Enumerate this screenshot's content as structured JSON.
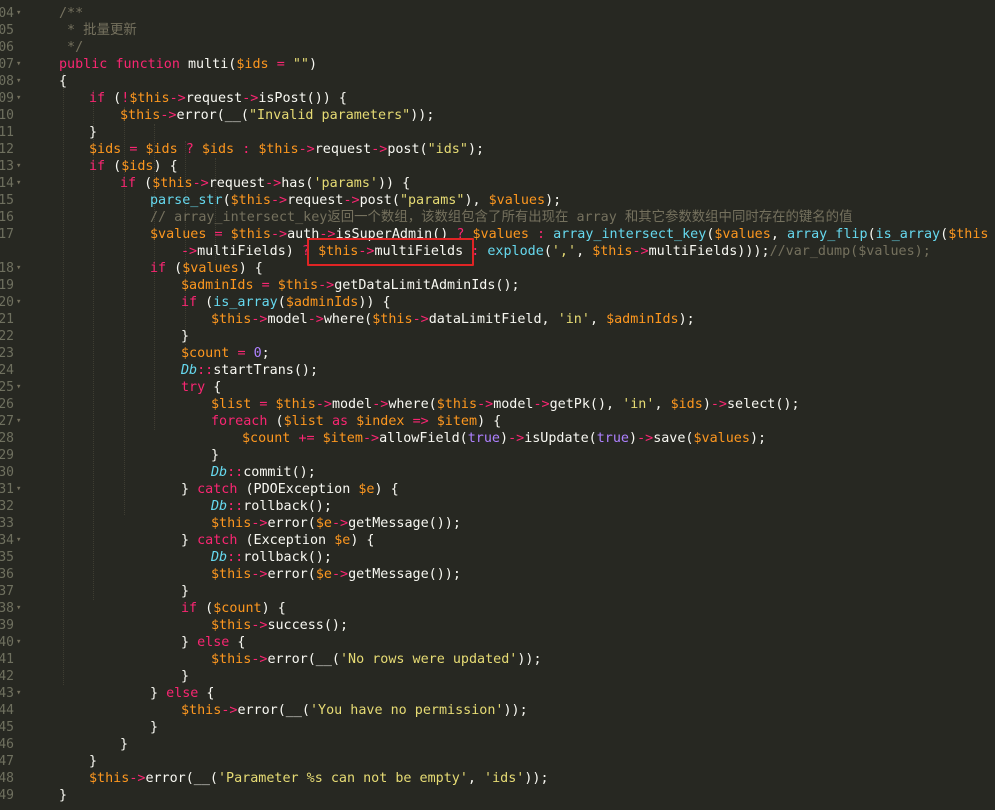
{
  "editor": {
    "line_numbers": [
      "04",
      "05",
      "06",
      "07",
      "08",
      "09",
      "10",
      "11",
      "12",
      "13",
      "14",
      "15",
      "16",
      "17",
      "",
      "18",
      "19",
      "20",
      "21",
      "22",
      "23",
      "24",
      "25",
      "26",
      "27",
      "28",
      "29",
      "30",
      "31",
      "32",
      "33",
      "34",
      "35",
      "36",
      "37",
      "38",
      "39",
      "40",
      "41",
      "42",
      "43",
      "44",
      "45",
      "46",
      "47",
      "48",
      "49"
    ],
    "lines": [
      [
        [
          "cm",
          "/**"
        ]
      ],
      [
        [
          "cm",
          " * 批量更新"
        ]
      ],
      [
        [
          "cm",
          " */"
        ]
      ],
      [
        [
          "kw",
          "public"
        ],
        [
          "txt",
          " "
        ],
        [
          "kw",
          "function"
        ],
        [
          "txt",
          " multi("
        ],
        [
          "var",
          "$ids"
        ],
        [
          "txt",
          " "
        ],
        [
          "kw",
          "="
        ],
        [
          "txt",
          " "
        ],
        [
          "str",
          "\"\""
        ],
        [
          "txt",
          ")"
        ]
      ],
      [
        [
          "txt",
          "{"
        ]
      ],
      [
        [
          "kw",
          "if"
        ],
        [
          "txt",
          " ("
        ],
        [
          "kw",
          "!"
        ],
        [
          "var",
          "$this"
        ],
        [
          "kw",
          "->"
        ],
        [
          "txt",
          "request"
        ],
        [
          "kw",
          "->"
        ],
        [
          "txt",
          "isPost()) {"
        ]
      ],
      [
        [
          "var",
          "$this"
        ],
        [
          "kw",
          "->"
        ],
        [
          "txt",
          "error(__("
        ],
        [
          "str",
          "\"Invalid parameters\""
        ],
        [
          "txt",
          "));"
        ]
      ],
      [
        [
          "txt",
          "}"
        ]
      ],
      [
        [
          "var",
          "$ids"
        ],
        [
          "txt",
          " "
        ],
        [
          "kw",
          "="
        ],
        [
          "txt",
          " "
        ],
        [
          "var",
          "$ids"
        ],
        [
          "txt",
          " "
        ],
        [
          "kw",
          "?"
        ],
        [
          "txt",
          " "
        ],
        [
          "var",
          "$ids"
        ],
        [
          "txt",
          " "
        ],
        [
          "kw",
          ":"
        ],
        [
          "txt",
          " "
        ],
        [
          "var",
          "$this"
        ],
        [
          "kw",
          "->"
        ],
        [
          "txt",
          "request"
        ],
        [
          "kw",
          "->"
        ],
        [
          "txt",
          "post("
        ],
        [
          "str",
          "\"ids\""
        ],
        [
          "txt",
          ");"
        ]
      ],
      [
        [
          "kw",
          "if"
        ],
        [
          "txt",
          " ("
        ],
        [
          "var",
          "$ids"
        ],
        [
          "txt",
          ") {"
        ]
      ],
      [
        [
          "kw",
          "if"
        ],
        [
          "txt",
          " ("
        ],
        [
          "var",
          "$this"
        ],
        [
          "kw",
          "->"
        ],
        [
          "txt",
          "request"
        ],
        [
          "kw",
          "->"
        ],
        [
          "txt",
          "has("
        ],
        [
          "str",
          "'params'"
        ],
        [
          "txt",
          ")) {"
        ]
      ],
      [
        [
          "fn",
          "parse_str"
        ],
        [
          "txt",
          "("
        ],
        [
          "var",
          "$this"
        ],
        [
          "kw",
          "->"
        ],
        [
          "txt",
          "request"
        ],
        [
          "kw",
          "->"
        ],
        [
          "txt",
          "post("
        ],
        [
          "str",
          "\"params\""
        ],
        [
          "txt",
          "), "
        ],
        [
          "var",
          "$values"
        ],
        [
          "txt",
          ");"
        ]
      ],
      [
        [
          "cm",
          "// array_intersect_key返回一个数组，该数组包含了所有出现在 array 和其它参数数组中同时存在的键名的值"
        ]
      ],
      [
        [
          "var",
          "$values"
        ],
        [
          "txt",
          " "
        ],
        [
          "kw",
          "="
        ],
        [
          "txt",
          " "
        ],
        [
          "var",
          "$this"
        ],
        [
          "kw",
          "->"
        ],
        [
          "txt",
          "auth"
        ],
        [
          "kw",
          "->"
        ],
        [
          "txt",
          "isSuperAdmin() "
        ],
        [
          "kw",
          "?"
        ],
        [
          "txt",
          " "
        ],
        [
          "var",
          "$values"
        ],
        [
          "txt",
          " "
        ],
        [
          "kw",
          ":"
        ],
        [
          "txt",
          " "
        ],
        [
          "fn",
          "array_intersect_key"
        ],
        [
          "txt",
          "("
        ],
        [
          "var",
          "$values"
        ],
        [
          "txt",
          ", "
        ],
        [
          "fn",
          "array_flip"
        ],
        [
          "txt",
          "("
        ],
        [
          "fn",
          "is_array"
        ],
        [
          "txt",
          "("
        ],
        [
          "var",
          "$this"
        ]
      ],
      [
        [
          "kw",
          "->"
        ],
        [
          "txt",
          "multiFields) "
        ],
        [
          "kw",
          "?"
        ],
        [
          "txt",
          " "
        ],
        [
          "var",
          "$this"
        ],
        [
          "kw",
          "->"
        ],
        [
          "txt",
          "multiFields "
        ],
        [
          "kw",
          ":"
        ],
        [
          "txt",
          " "
        ],
        [
          "fn",
          "explode"
        ],
        [
          "txt",
          "("
        ],
        [
          "str",
          "','"
        ],
        [
          "txt",
          ", "
        ],
        [
          "var",
          "$this"
        ],
        [
          "kw",
          "->"
        ],
        [
          "txt",
          "multiFields)));"
        ],
        [
          "cm",
          "//var_dump($values);"
        ]
      ],
      [
        [
          "kw",
          "if"
        ],
        [
          "txt",
          " ("
        ],
        [
          "var",
          "$values"
        ],
        [
          "txt",
          ") {"
        ]
      ],
      [
        [
          "var",
          "$adminIds"
        ],
        [
          "txt",
          " "
        ],
        [
          "kw",
          "="
        ],
        [
          "txt",
          " "
        ],
        [
          "var",
          "$this"
        ],
        [
          "kw",
          "->"
        ],
        [
          "txt",
          "getDataLimitAdminIds();"
        ]
      ],
      [
        [
          "kw",
          "if"
        ],
        [
          "txt",
          " ("
        ],
        [
          "fn",
          "is_array"
        ],
        [
          "txt",
          "("
        ],
        [
          "var",
          "$adminIds"
        ],
        [
          "txt",
          ")) {"
        ]
      ],
      [
        [
          "var",
          "$this"
        ],
        [
          "kw",
          "->"
        ],
        [
          "txt",
          "model"
        ],
        [
          "kw",
          "->"
        ],
        [
          "txt",
          "where("
        ],
        [
          "var",
          "$this"
        ],
        [
          "kw",
          "->"
        ],
        [
          "txt",
          "dataLimitField, "
        ],
        [
          "str",
          "'in'"
        ],
        [
          "txt",
          ", "
        ],
        [
          "var",
          "$adminIds"
        ],
        [
          "txt",
          ");"
        ]
      ],
      [
        [
          "txt",
          "}"
        ]
      ],
      [
        [
          "var",
          "$count"
        ],
        [
          "txt",
          " "
        ],
        [
          "kw",
          "="
        ],
        [
          "txt",
          " "
        ],
        [
          "num",
          "0"
        ],
        [
          "txt",
          ";"
        ]
      ],
      [
        [
          "cls",
          "Db"
        ],
        [
          "kw",
          "::"
        ],
        [
          "txt",
          "startTrans();"
        ]
      ],
      [
        [
          "kw",
          "try"
        ],
        [
          "txt",
          " {"
        ]
      ],
      [
        [
          "var",
          "$list"
        ],
        [
          "txt",
          " "
        ],
        [
          "kw",
          "="
        ],
        [
          "txt",
          " "
        ],
        [
          "var",
          "$this"
        ],
        [
          "kw",
          "->"
        ],
        [
          "txt",
          "model"
        ],
        [
          "kw",
          "->"
        ],
        [
          "txt",
          "where("
        ],
        [
          "var",
          "$this"
        ],
        [
          "kw",
          "->"
        ],
        [
          "txt",
          "model"
        ],
        [
          "kw",
          "->"
        ],
        [
          "txt",
          "getPk(), "
        ],
        [
          "str",
          "'in'"
        ],
        [
          "txt",
          ", "
        ],
        [
          "var",
          "$ids"
        ],
        [
          "txt",
          ")"
        ],
        [
          "kw",
          "->"
        ],
        [
          "txt",
          "select();"
        ]
      ],
      [
        [
          "kw",
          "foreach"
        ],
        [
          "txt",
          " ("
        ],
        [
          "var",
          "$list"
        ],
        [
          "txt",
          " "
        ],
        [
          "kw",
          "as"
        ],
        [
          "txt",
          " "
        ],
        [
          "var",
          "$index"
        ],
        [
          "txt",
          " "
        ],
        [
          "kw",
          "=>"
        ],
        [
          "txt",
          " "
        ],
        [
          "var",
          "$item"
        ],
        [
          "txt",
          ") {"
        ]
      ],
      [
        [
          "var",
          "$count"
        ],
        [
          "txt",
          " "
        ],
        [
          "kw",
          "+="
        ],
        [
          "txt",
          " "
        ],
        [
          "var",
          "$item"
        ],
        [
          "kw",
          "->"
        ],
        [
          "txt",
          "allowField("
        ],
        [
          "num",
          "true"
        ],
        [
          "txt",
          ")"
        ],
        [
          "kw",
          "->"
        ],
        [
          "txt",
          "isUpdate("
        ],
        [
          "num",
          "true"
        ],
        [
          "txt",
          ")"
        ],
        [
          "kw",
          "->"
        ],
        [
          "txt",
          "save("
        ],
        [
          "var",
          "$values"
        ],
        [
          "txt",
          ");"
        ]
      ],
      [
        [
          "txt",
          "}"
        ]
      ],
      [
        [
          "cls",
          "Db"
        ],
        [
          "kw",
          "::"
        ],
        [
          "txt",
          "commit();"
        ]
      ],
      [
        [
          "txt",
          "} "
        ],
        [
          "kw",
          "catch"
        ],
        [
          "txt",
          " (PDOException "
        ],
        [
          "var",
          "$e"
        ],
        [
          "txt",
          ") {"
        ]
      ],
      [
        [
          "cls",
          "Db"
        ],
        [
          "kw",
          "::"
        ],
        [
          "txt",
          "rollback();"
        ]
      ],
      [
        [
          "var",
          "$this"
        ],
        [
          "kw",
          "->"
        ],
        [
          "txt",
          "error("
        ],
        [
          "var",
          "$e"
        ],
        [
          "kw",
          "->"
        ],
        [
          "txt",
          "getMessage());"
        ]
      ],
      [
        [
          "txt",
          "} "
        ],
        [
          "kw",
          "catch"
        ],
        [
          "txt",
          " (Exception "
        ],
        [
          "var",
          "$e"
        ],
        [
          "txt",
          ") {"
        ]
      ],
      [
        [
          "cls",
          "Db"
        ],
        [
          "kw",
          "::"
        ],
        [
          "txt",
          "rollback();"
        ]
      ],
      [
        [
          "var",
          "$this"
        ],
        [
          "kw",
          "->"
        ],
        [
          "txt",
          "error("
        ],
        [
          "var",
          "$e"
        ],
        [
          "kw",
          "->"
        ],
        [
          "txt",
          "getMessage());"
        ]
      ],
      [
        [
          "txt",
          "}"
        ]
      ],
      [
        [
          "kw",
          "if"
        ],
        [
          "txt",
          " ("
        ],
        [
          "var",
          "$count"
        ],
        [
          "txt",
          ") {"
        ]
      ],
      [
        [
          "var",
          "$this"
        ],
        [
          "kw",
          "->"
        ],
        [
          "txt",
          "success();"
        ]
      ],
      [
        [
          "txt",
          "} "
        ],
        [
          "kw",
          "else"
        ],
        [
          "txt",
          " {"
        ]
      ],
      [
        [
          "var",
          "$this"
        ],
        [
          "kw",
          "->"
        ],
        [
          "txt",
          "error(__("
        ],
        [
          "str",
          "'No rows were updated'"
        ],
        [
          "txt",
          "));"
        ]
      ],
      [
        [
          "txt",
          "}"
        ]
      ],
      [
        [
          "txt",
          "} "
        ],
        [
          "kw",
          "else"
        ],
        [
          "txt",
          " {"
        ]
      ],
      [
        [
          "var",
          "$this"
        ],
        [
          "kw",
          "->"
        ],
        [
          "txt",
          "error(__("
        ],
        [
          "str",
          "'You have no permission'"
        ],
        [
          "txt",
          "));"
        ]
      ],
      [
        [
          "txt",
          "}"
        ]
      ],
      [
        [
          "txt",
          "}"
        ]
      ],
      [
        [
          "txt",
          "}"
        ]
      ],
      [
        [
          "var",
          "$this"
        ],
        [
          "kw",
          "->"
        ],
        [
          "txt",
          "error(__("
        ],
        [
          "str",
          "'Parameter %s can not be empty'"
        ],
        [
          "txt",
          ", "
        ],
        [
          "str",
          "'ids'"
        ],
        [
          "txt",
          "));"
        ]
      ],
      [
        [
          "txt",
          "}"
        ]
      ]
    ],
    "highlighted_text": "$this->multiFields :",
    "colors": {
      "background": "#272822",
      "keyword": "#f92672",
      "variable": "#fd971f",
      "string": "#e6db74",
      "number": "#ae81ff",
      "function": "#66d9ef",
      "comment": "#75715e",
      "text": "#f8f8f2",
      "highlight_box": "#e02424"
    }
  }
}
